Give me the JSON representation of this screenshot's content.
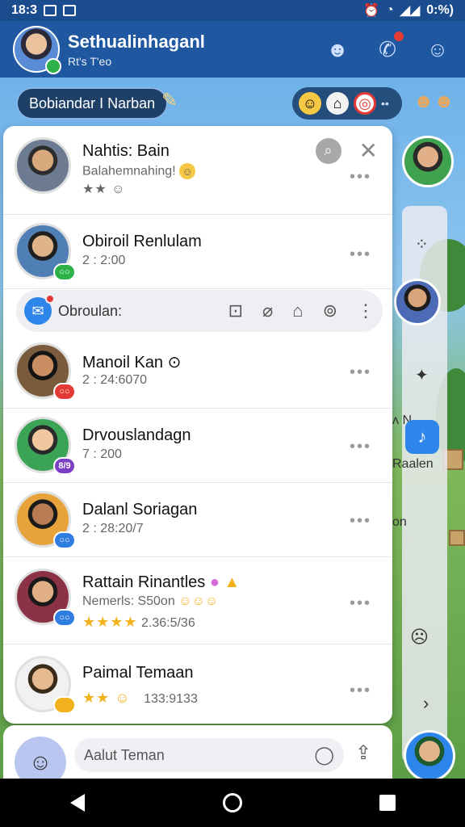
{
  "status_bar": {
    "time": "18:3",
    "battery": "0:%)"
  },
  "app_bar": {
    "title": "Sethualinhaganl",
    "subtitle": "Rt's T'eo"
  },
  "game_strip": {
    "name_pill": "Bobiandar I Narban"
  },
  "contacts": [
    {
      "name": "Nahtis: Bain",
      "line2": "Balahemnahing!",
      "line3": ""
    },
    {
      "name": "Obiroil Renlulam",
      "line2": "2 : 2:00",
      "line3": ""
    },
    {
      "name": "Manoil Kan ⊙",
      "line2": "2 : 24:6070",
      "line3": ""
    },
    {
      "name": "Drvouslandagn",
      "line2": "7 : 200",
      "line3": ""
    },
    {
      "name": "Dalanl Soriagan",
      "line2": "2 : 28:20/7",
      "line3": ""
    },
    {
      "name": "Rattain Rinantles",
      "line2": "Nemerls: S50on ",
      "line3": "2.36:5/36"
    },
    {
      "name": "Paimal Temaan",
      "line2": "",
      "line3": "133:9133"
    }
  ],
  "contact_badges": [
    "",
    "○○",
    "○○",
    "8/9",
    "○○",
    "○○",
    ""
  ],
  "action_strip": {
    "label": "Obroulan:"
  },
  "bottom_bar": {
    "input_placeholder": "Aalut Teman"
  },
  "side_labels": {
    "a": "ʌ N",
    "b": "Raalen",
    "c": "on"
  },
  "icons": {
    "search": "search-icon",
    "close": "close-icon",
    "more": "more-dots-icon",
    "messenger": "messenger-icon",
    "chat": "chat-bubble-icon",
    "share": "share-icon",
    "back": "back-triangle-icon",
    "home": "home-circle-icon",
    "recents": "recents-square-icon"
  },
  "colors": {
    "app_bar": "#1f58a0",
    "status_bar": "#1b4c8e",
    "accent_red": "#e53935",
    "accent_blue": "#2f86ea"
  }
}
